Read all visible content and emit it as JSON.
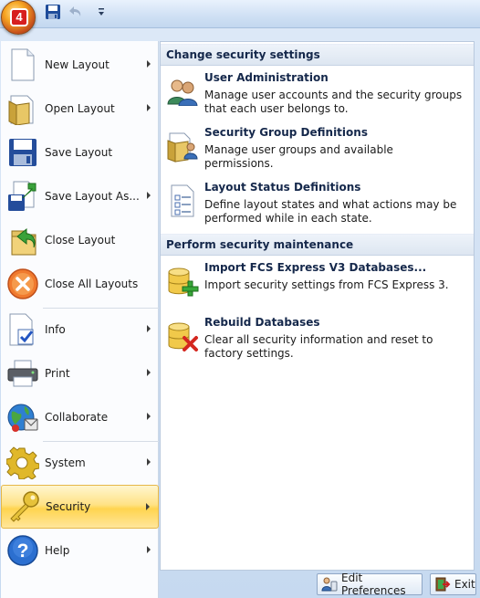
{
  "quick_access": {
    "save_icon": "save-icon",
    "undo_icon": "undo-icon",
    "customize_icon": "customize-qat-icon"
  },
  "app_button": {
    "badge": "4"
  },
  "left_menu": {
    "items": [
      {
        "label": "New Layout",
        "icon": "new-document-icon",
        "submenu": true
      },
      {
        "label": "Open Layout",
        "icon": "open-folder-icon",
        "submenu": true
      },
      {
        "label": "Save Layout",
        "icon": "floppy-disk-icon",
        "submenu": false
      },
      {
        "label": "Save Layout As...",
        "icon": "save-as-icon",
        "submenu": true
      },
      {
        "label": "Close Layout",
        "icon": "close-layout-icon",
        "submenu": false
      },
      {
        "label": "Close All Layouts",
        "icon": "close-all-icon",
        "submenu": false
      },
      {
        "label": "Info",
        "icon": "info-icon",
        "submenu": true
      },
      {
        "label": "Print",
        "icon": "printer-icon",
        "submenu": true
      },
      {
        "label": "Collaborate",
        "icon": "collaborate-icon",
        "submenu": true
      },
      {
        "label": "System",
        "icon": "gear-icon",
        "submenu": true
      },
      {
        "label": "Security",
        "icon": "key-icon",
        "submenu": true,
        "selected": true
      },
      {
        "label": "Help",
        "icon": "help-icon",
        "submenu": true
      }
    ]
  },
  "right_panel": {
    "sections": [
      {
        "header": "Change security settings",
        "entries": [
          {
            "title": "User Administration",
            "description": "Manage user accounts and the security groups that each user belongs to.",
            "icon": "users-icon"
          },
          {
            "title": "Security Group Definitions",
            "description": "Manage user groups and available permissions.",
            "icon": "group-folder-icon"
          },
          {
            "title": "Layout Status Definitions",
            "description": "Define layout states and what actions may be performed while in each state.",
            "icon": "checklist-icon"
          }
        ]
      },
      {
        "header": "Perform security maintenance",
        "entries": [
          {
            "title": "Import FCS Express V3 Databases...",
            "description": "Import security settings from FCS Express 3.",
            "icon": "database-add-icon"
          },
          {
            "title": "Rebuild Databases",
            "description": "Clear all security information and reset to factory settings.",
            "icon": "database-delete-icon"
          }
        ]
      }
    ]
  },
  "bottom_bar": {
    "preferences_label": "Edit Preferences",
    "exit_label": "Exit"
  },
  "colors": {
    "selected_highlight": "#ffd44f",
    "section_header_text": "#15284b",
    "frame_background": "#c6d9f0"
  }
}
